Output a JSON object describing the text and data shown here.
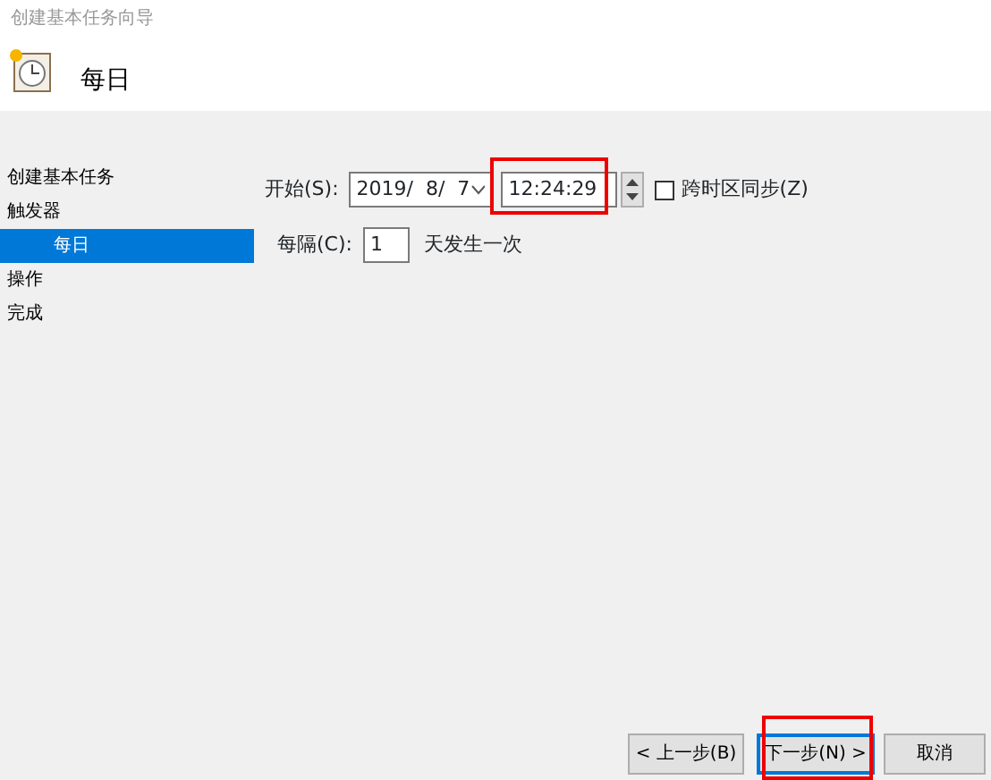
{
  "window": {
    "title": "创建基本任务向导"
  },
  "header": {
    "title": "每日"
  },
  "sidebar": {
    "items": [
      {
        "label": "创建基本任务",
        "selected": false
      },
      {
        "label": "触发器",
        "selected": false,
        "children": [
          {
            "label": "每日",
            "selected": true
          }
        ]
      },
      {
        "label": "操作",
        "selected": false
      },
      {
        "label": "完成",
        "selected": false
      }
    ]
  },
  "start": {
    "label": "开始(S):",
    "date": "2019/  8/  7",
    "time": "12:24:29",
    "time_highlighted": true,
    "sync": {
      "label": "跨时区同步(Z)",
      "checked": false
    }
  },
  "recur": {
    "label": "每隔(C):",
    "value": "1",
    "suffix": "天发生一次"
  },
  "buttons": [
    {
      "label": "< 上一步(B)",
      "focused": false,
      "highlighted": false
    },
    {
      "label": "下一步(N) >",
      "focused": true,
      "highlighted": true
    },
    {
      "label": "取消",
      "focused": false,
      "highlighted": false
    }
  ]
}
